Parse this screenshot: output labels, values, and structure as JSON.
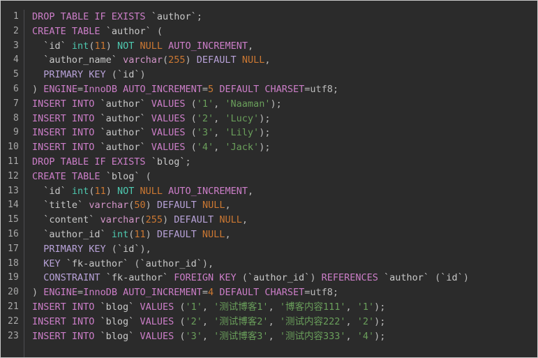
{
  "editor": {
    "name": "sql-code-viewer",
    "language": "sql",
    "theme": "dark",
    "background_color": "#2b2b2b",
    "gutter_color": "#a9a9a9",
    "total_lines": 23,
    "colors": {
      "keyword": "#cc7ec8",
      "keyword_alt": "#b8a2d8",
      "type": "#d294c8",
      "builtin": "#4ec9b0",
      "constant": "#cc7832",
      "number": "#cc7832",
      "string": "#6a9f5b",
      "identifier": "#c8c8c8",
      "plain": "#bcbcbc"
    }
  },
  "line_numbers": [
    1,
    2,
    3,
    4,
    5,
    6,
    7,
    8,
    9,
    10,
    11,
    12,
    13,
    14,
    15,
    16,
    17,
    18,
    19,
    20,
    21,
    22,
    23
  ],
  "plain_text": [
    "DROP TABLE IF EXISTS `author`;",
    "CREATE TABLE `author` (",
    "  `id` int(11) NOT NULL AUTO_INCREMENT,",
    "  `author_name` varchar(255) DEFAULT NULL,",
    "  PRIMARY KEY (`id`)",
    ") ENGINE=InnoDB AUTO_INCREMENT=5 DEFAULT CHARSET=utf8;",
    "INSERT INTO `author` VALUES ('1', 'Naaman');",
    "INSERT INTO `author` VALUES ('2', 'Lucy');",
    "INSERT INTO `author` VALUES ('3', 'Lily');",
    "INSERT INTO `author` VALUES ('4', 'Jack');",
    "DROP TABLE IF EXISTS `blog`;",
    "CREATE TABLE `blog` (",
    "  `id` int(11) NOT NULL AUTO_INCREMENT,",
    "  `title` varchar(50) DEFAULT NULL,",
    "  `content` varchar(255) DEFAULT NULL,",
    "  `author_id` int(11) DEFAULT NULL,",
    "  PRIMARY KEY (`id`),",
    "  KEY `fk-author` (`author_id`),",
    "  CONSTRAINT `fk-author` FOREIGN KEY (`author_id`) REFERENCES `author` (`id`)",
    ") ENGINE=InnoDB AUTO_INCREMENT=4 DEFAULT CHARSET=utf8;",
    "INSERT INTO `blog` VALUES ('1', '测试博客1', '博客内容111', '1');",
    "INSERT INTO `blog` VALUES ('2', '测试博客2', '测试内容222', '2');",
    "INSERT INTO `blog` VALUES ('3', '测试博客3', '测试内容333', '4');"
  ],
  "lines": [
    [
      {
        "t": "DROP TABLE IF EXISTS",
        "c": "kw"
      },
      {
        "t": " ",
        "c": "plain"
      },
      {
        "t": "`author`",
        "c": "ident"
      },
      {
        "t": ";",
        "c": "punc"
      }
    ],
    [
      {
        "t": "CREATE TABLE",
        "c": "kw"
      },
      {
        "t": " ",
        "c": "plain"
      },
      {
        "t": "`author`",
        "c": "ident"
      },
      {
        "t": " (",
        "c": "punc"
      }
    ],
    [
      {
        "t": "  ",
        "c": "plain"
      },
      {
        "t": "`id`",
        "c": "ident"
      },
      {
        "t": " ",
        "c": "plain"
      },
      {
        "t": "int",
        "c": "fn"
      },
      {
        "t": "(",
        "c": "punc"
      },
      {
        "t": "11",
        "c": "num"
      },
      {
        "t": ") ",
        "c": "punc"
      },
      {
        "t": "NOT",
        "c": "fn"
      },
      {
        "t": " ",
        "c": "plain"
      },
      {
        "t": "NULL",
        "c": "const"
      },
      {
        "t": " ",
        "c": "plain"
      },
      {
        "t": "AUTO_INCREMENT",
        "c": "kw"
      },
      {
        "t": ",",
        "c": "punc"
      }
    ],
    [
      {
        "t": "  ",
        "c": "plain"
      },
      {
        "t": "`author_name`",
        "c": "ident"
      },
      {
        "t": " ",
        "c": "plain"
      },
      {
        "t": "varchar",
        "c": "type"
      },
      {
        "t": "(",
        "c": "punc"
      },
      {
        "t": "255",
        "c": "num"
      },
      {
        "t": ") ",
        "c": "punc"
      },
      {
        "t": "DEFAULT",
        "c": "kw2"
      },
      {
        "t": " ",
        "c": "plain"
      },
      {
        "t": "NULL",
        "c": "const"
      },
      {
        "t": ",",
        "c": "punc"
      }
    ],
    [
      {
        "t": "  ",
        "c": "plain"
      },
      {
        "t": "PRIMARY KEY",
        "c": "kw2"
      },
      {
        "t": " (",
        "c": "punc"
      },
      {
        "t": "`id`",
        "c": "ident"
      },
      {
        "t": ")",
        "c": "punc"
      }
    ],
    [
      {
        "t": ") ",
        "c": "punc"
      },
      {
        "t": "ENGINE",
        "c": "kw"
      },
      {
        "t": "=",
        "c": "punc"
      },
      {
        "t": "InnoDB",
        "c": "kw"
      },
      {
        "t": " ",
        "c": "plain"
      },
      {
        "t": "AUTO_INCREMENT",
        "c": "kw"
      },
      {
        "t": "=",
        "c": "punc"
      },
      {
        "t": "5",
        "c": "num"
      },
      {
        "t": " ",
        "c": "plain"
      },
      {
        "t": "DEFAULT CHARSET",
        "c": "kw"
      },
      {
        "t": "=",
        "c": "punc"
      },
      {
        "t": "utf8",
        "c": "plain"
      },
      {
        "t": ";",
        "c": "punc"
      }
    ],
    [
      {
        "t": "INSERT INTO",
        "c": "kw"
      },
      {
        "t": " ",
        "c": "plain"
      },
      {
        "t": "`author`",
        "c": "ident"
      },
      {
        "t": " ",
        "c": "plain"
      },
      {
        "t": "VALUES",
        "c": "kw"
      },
      {
        "t": " (",
        "c": "punc"
      },
      {
        "t": "'1'",
        "c": "str"
      },
      {
        "t": ", ",
        "c": "punc"
      },
      {
        "t": "'Naaman'",
        "c": "str"
      },
      {
        "t": ");",
        "c": "punc"
      }
    ],
    [
      {
        "t": "INSERT INTO",
        "c": "kw"
      },
      {
        "t": " ",
        "c": "plain"
      },
      {
        "t": "`author`",
        "c": "ident"
      },
      {
        "t": " ",
        "c": "plain"
      },
      {
        "t": "VALUES",
        "c": "kw"
      },
      {
        "t": " (",
        "c": "punc"
      },
      {
        "t": "'2'",
        "c": "str"
      },
      {
        "t": ", ",
        "c": "punc"
      },
      {
        "t": "'Lucy'",
        "c": "str"
      },
      {
        "t": ");",
        "c": "punc"
      }
    ],
    [
      {
        "t": "INSERT INTO",
        "c": "kw"
      },
      {
        "t": " ",
        "c": "plain"
      },
      {
        "t": "`author`",
        "c": "ident"
      },
      {
        "t": " ",
        "c": "plain"
      },
      {
        "t": "VALUES",
        "c": "kw"
      },
      {
        "t": " (",
        "c": "punc"
      },
      {
        "t": "'3'",
        "c": "str"
      },
      {
        "t": ", ",
        "c": "punc"
      },
      {
        "t": "'Lily'",
        "c": "str"
      },
      {
        "t": ");",
        "c": "punc"
      }
    ],
    [
      {
        "t": "INSERT INTO",
        "c": "kw"
      },
      {
        "t": " ",
        "c": "plain"
      },
      {
        "t": "`author`",
        "c": "ident"
      },
      {
        "t": " ",
        "c": "plain"
      },
      {
        "t": "VALUES",
        "c": "kw"
      },
      {
        "t": " (",
        "c": "punc"
      },
      {
        "t": "'4'",
        "c": "str"
      },
      {
        "t": ", ",
        "c": "punc"
      },
      {
        "t": "'Jack'",
        "c": "str"
      },
      {
        "t": ");",
        "c": "punc"
      }
    ],
    [
      {
        "t": "DROP TABLE IF EXISTS",
        "c": "kw"
      },
      {
        "t": " ",
        "c": "plain"
      },
      {
        "t": "`blog`",
        "c": "ident"
      },
      {
        "t": ";",
        "c": "punc"
      }
    ],
    [
      {
        "t": "CREATE TABLE",
        "c": "kw"
      },
      {
        "t": " ",
        "c": "plain"
      },
      {
        "t": "`blog`",
        "c": "ident"
      },
      {
        "t": " (",
        "c": "punc"
      }
    ],
    [
      {
        "t": "  ",
        "c": "plain"
      },
      {
        "t": "`id`",
        "c": "ident"
      },
      {
        "t": " ",
        "c": "plain"
      },
      {
        "t": "int",
        "c": "fn"
      },
      {
        "t": "(",
        "c": "punc"
      },
      {
        "t": "11",
        "c": "num"
      },
      {
        "t": ") ",
        "c": "punc"
      },
      {
        "t": "NOT",
        "c": "fn"
      },
      {
        "t": " ",
        "c": "plain"
      },
      {
        "t": "NULL",
        "c": "const"
      },
      {
        "t": " ",
        "c": "plain"
      },
      {
        "t": "AUTO_INCREMENT",
        "c": "kw"
      },
      {
        "t": ",",
        "c": "punc"
      }
    ],
    [
      {
        "t": "  ",
        "c": "plain"
      },
      {
        "t": "`title`",
        "c": "ident"
      },
      {
        "t": " ",
        "c": "plain"
      },
      {
        "t": "varchar",
        "c": "type"
      },
      {
        "t": "(",
        "c": "punc"
      },
      {
        "t": "50",
        "c": "num"
      },
      {
        "t": ") ",
        "c": "punc"
      },
      {
        "t": "DEFAULT",
        "c": "kw2"
      },
      {
        "t": " ",
        "c": "plain"
      },
      {
        "t": "NULL",
        "c": "const"
      },
      {
        "t": ",",
        "c": "punc"
      }
    ],
    [
      {
        "t": "  ",
        "c": "plain"
      },
      {
        "t": "`content`",
        "c": "ident"
      },
      {
        "t": " ",
        "c": "plain"
      },
      {
        "t": "varchar",
        "c": "type"
      },
      {
        "t": "(",
        "c": "punc"
      },
      {
        "t": "255",
        "c": "num"
      },
      {
        "t": ") ",
        "c": "punc"
      },
      {
        "t": "DEFAULT",
        "c": "kw2"
      },
      {
        "t": " ",
        "c": "plain"
      },
      {
        "t": "NULL",
        "c": "const"
      },
      {
        "t": ",",
        "c": "punc"
      }
    ],
    [
      {
        "t": "  ",
        "c": "plain"
      },
      {
        "t": "`author_id`",
        "c": "ident"
      },
      {
        "t": " ",
        "c": "plain"
      },
      {
        "t": "int",
        "c": "fn"
      },
      {
        "t": "(",
        "c": "punc"
      },
      {
        "t": "11",
        "c": "num"
      },
      {
        "t": ") ",
        "c": "punc"
      },
      {
        "t": "DEFAULT",
        "c": "kw2"
      },
      {
        "t": " ",
        "c": "plain"
      },
      {
        "t": "NULL",
        "c": "const"
      },
      {
        "t": ",",
        "c": "punc"
      }
    ],
    [
      {
        "t": "  ",
        "c": "plain"
      },
      {
        "t": "PRIMARY KEY",
        "c": "kw2"
      },
      {
        "t": " (",
        "c": "punc"
      },
      {
        "t": "`id`",
        "c": "ident"
      },
      {
        "t": "),",
        "c": "punc"
      }
    ],
    [
      {
        "t": "  ",
        "c": "plain"
      },
      {
        "t": "KEY",
        "c": "kw2"
      },
      {
        "t": " ",
        "c": "plain"
      },
      {
        "t": "`fk-author`",
        "c": "ident"
      },
      {
        "t": " (",
        "c": "punc"
      },
      {
        "t": "`author_id`",
        "c": "ident"
      },
      {
        "t": "),",
        "c": "punc"
      }
    ],
    [
      {
        "t": "  ",
        "c": "plain"
      },
      {
        "t": "CONSTRAINT",
        "c": "kw2"
      },
      {
        "t": " ",
        "c": "plain"
      },
      {
        "t": "`fk-author`",
        "c": "ident"
      },
      {
        "t": " ",
        "c": "plain"
      },
      {
        "t": "FOREIGN KEY",
        "c": "kw"
      },
      {
        "t": " (",
        "c": "punc"
      },
      {
        "t": "`author_id`",
        "c": "ident"
      },
      {
        "t": ") ",
        "c": "punc"
      },
      {
        "t": "REFERENCES",
        "c": "kw"
      },
      {
        "t": " ",
        "c": "plain"
      },
      {
        "t": "`author`",
        "c": "ident"
      },
      {
        "t": " (",
        "c": "punc"
      },
      {
        "t": "`id`",
        "c": "ident"
      },
      {
        "t": ")",
        "c": "punc"
      }
    ],
    [
      {
        "t": ") ",
        "c": "punc"
      },
      {
        "t": "ENGINE",
        "c": "kw"
      },
      {
        "t": "=",
        "c": "punc"
      },
      {
        "t": "InnoDB",
        "c": "kw"
      },
      {
        "t": " ",
        "c": "plain"
      },
      {
        "t": "AUTO_INCREMENT",
        "c": "kw"
      },
      {
        "t": "=",
        "c": "punc"
      },
      {
        "t": "4",
        "c": "num"
      },
      {
        "t": " ",
        "c": "plain"
      },
      {
        "t": "DEFAULT CHARSET",
        "c": "kw"
      },
      {
        "t": "=",
        "c": "punc"
      },
      {
        "t": "utf8",
        "c": "plain"
      },
      {
        "t": ";",
        "c": "punc"
      }
    ],
    [
      {
        "t": "INSERT INTO",
        "c": "kw"
      },
      {
        "t": " ",
        "c": "plain"
      },
      {
        "t": "`blog`",
        "c": "ident"
      },
      {
        "t": " ",
        "c": "plain"
      },
      {
        "t": "VALUES",
        "c": "kw"
      },
      {
        "t": " (",
        "c": "punc"
      },
      {
        "t": "'1'",
        "c": "str"
      },
      {
        "t": ", ",
        "c": "punc"
      },
      {
        "t": "'测试博客1'",
        "c": "str"
      },
      {
        "t": ", ",
        "c": "punc"
      },
      {
        "t": "'博客内容111'",
        "c": "str"
      },
      {
        "t": ", ",
        "c": "punc"
      },
      {
        "t": "'1'",
        "c": "str"
      },
      {
        "t": ");",
        "c": "punc"
      }
    ],
    [
      {
        "t": "INSERT INTO",
        "c": "kw"
      },
      {
        "t": " ",
        "c": "plain"
      },
      {
        "t": "`blog`",
        "c": "ident"
      },
      {
        "t": " ",
        "c": "plain"
      },
      {
        "t": "VALUES",
        "c": "kw"
      },
      {
        "t": " (",
        "c": "punc"
      },
      {
        "t": "'2'",
        "c": "str"
      },
      {
        "t": ", ",
        "c": "punc"
      },
      {
        "t": "'测试博客2'",
        "c": "str"
      },
      {
        "t": ", ",
        "c": "punc"
      },
      {
        "t": "'测试内容222'",
        "c": "str"
      },
      {
        "t": ", ",
        "c": "punc"
      },
      {
        "t": "'2'",
        "c": "str"
      },
      {
        "t": ");",
        "c": "punc"
      }
    ],
    [
      {
        "t": "INSERT INTO",
        "c": "kw"
      },
      {
        "t": " ",
        "c": "plain"
      },
      {
        "t": "`blog`",
        "c": "ident"
      },
      {
        "t": " ",
        "c": "plain"
      },
      {
        "t": "VALUES",
        "c": "kw"
      },
      {
        "t": " (",
        "c": "punc"
      },
      {
        "t": "'3'",
        "c": "str"
      },
      {
        "t": ", ",
        "c": "punc"
      },
      {
        "t": "'测试博客3'",
        "c": "str"
      },
      {
        "t": ", ",
        "c": "punc"
      },
      {
        "t": "'测试内容333'",
        "c": "str"
      },
      {
        "t": ", ",
        "c": "punc"
      },
      {
        "t": "'4'",
        "c": "str"
      },
      {
        "t": ");",
        "c": "punc"
      }
    ]
  ]
}
